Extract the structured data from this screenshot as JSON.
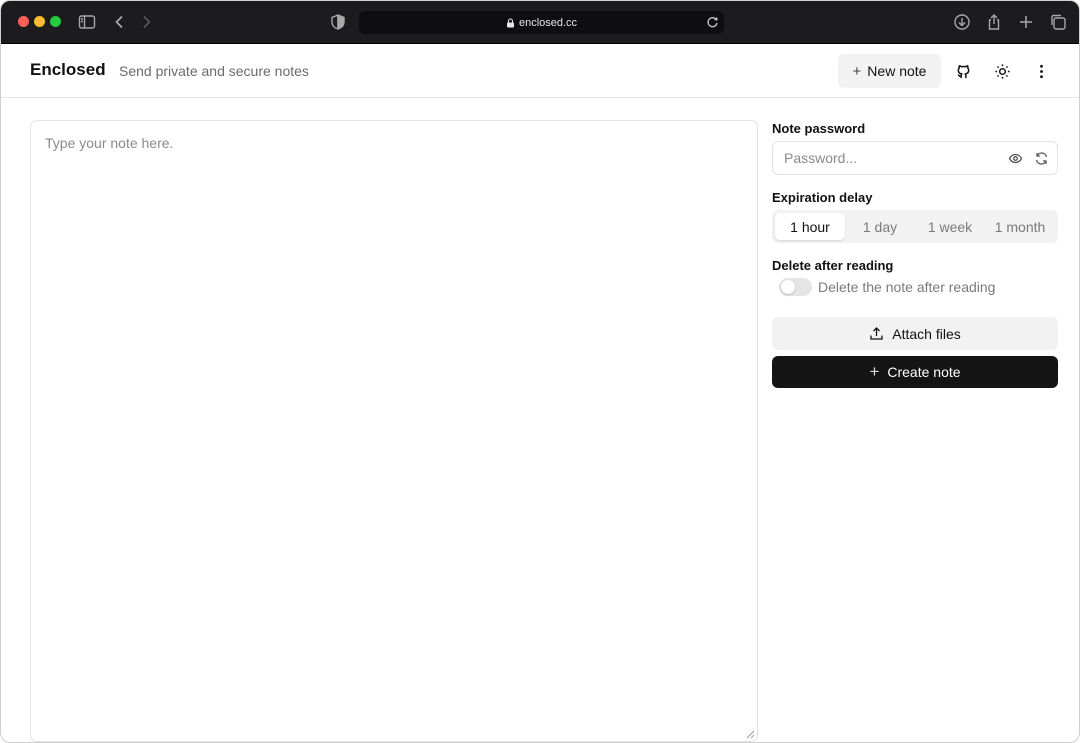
{
  "browser": {
    "url": "enclosed.cc"
  },
  "header": {
    "brand": "Enclosed",
    "tagline": "Send private and secure notes",
    "new_note_label": "New note"
  },
  "editor": {
    "placeholder": "Type your note here."
  },
  "panel": {
    "password_label": "Note password",
    "password_placeholder": "Password...",
    "expiration_label": "Expiration delay",
    "expiration_options": [
      "1 hour",
      "1 day",
      "1 week",
      "1 month"
    ],
    "expiration_selected": "1 hour",
    "delete_label": "Delete after reading",
    "delete_toggle_label": "Delete the note after reading",
    "delete_enabled": false,
    "attach_label": "Attach files",
    "create_label": "Create note"
  },
  "colors": {
    "chrome_bg": "#1c1c1e",
    "primary_button": "#141414",
    "muted_text": "#7a7a7a"
  }
}
